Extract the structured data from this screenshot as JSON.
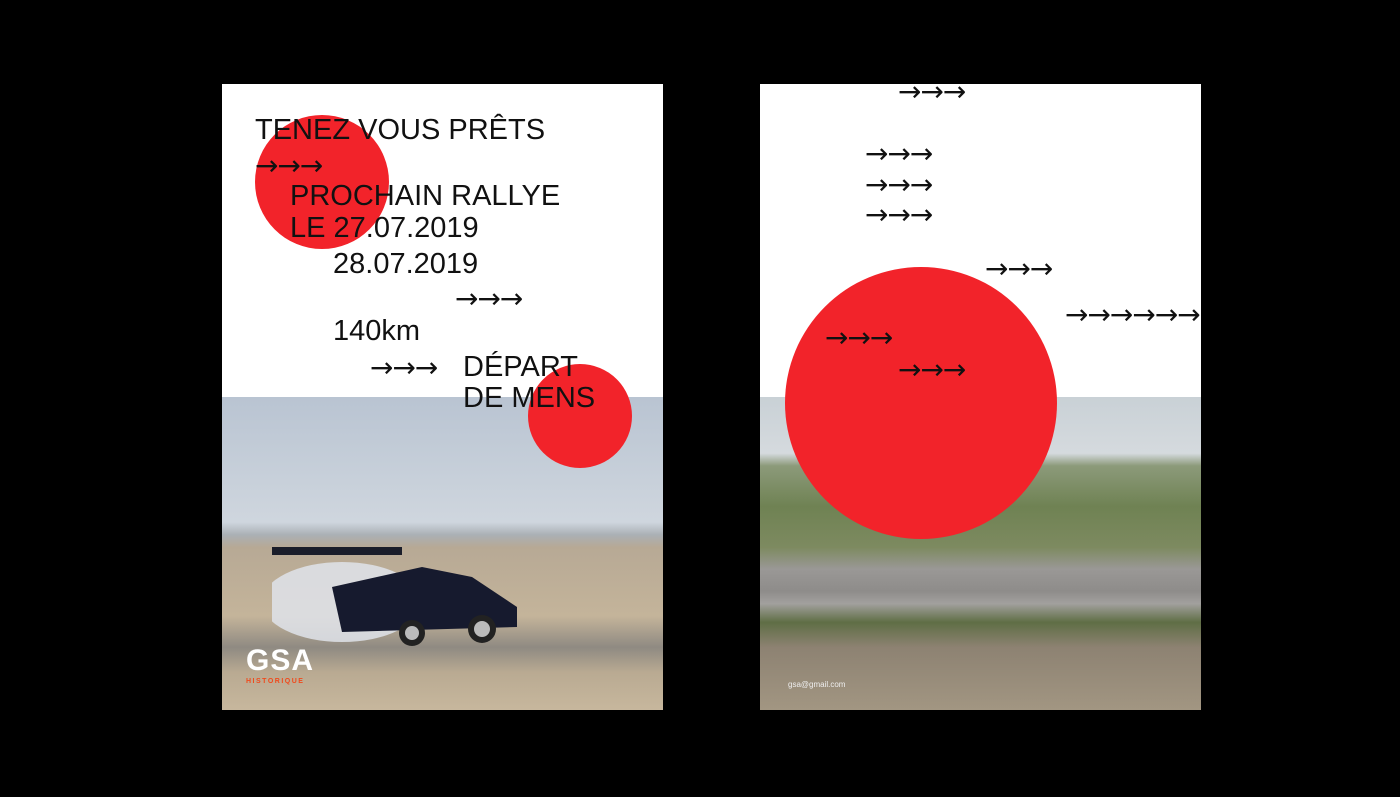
{
  "poster_left": {
    "headline": "TENEZ VOUS PRÊTS",
    "line1": "PROCHAIN RALLYE",
    "line2": "LE 27.07.2019",
    "line3": "28.07.2019",
    "distance": "140km",
    "depart1": "DÉPART",
    "depart2": "DE MENS",
    "arrows": "→→→",
    "logo_main": "GSA",
    "logo_sub": "HISTORIQUE"
  },
  "poster_right": {
    "arrows3": "→→→",
    "arrows6": "→→→→→→",
    "email": "gsa@gmail.com"
  },
  "colors": {
    "accent_red": "#f2232a",
    "background": "#000000"
  }
}
